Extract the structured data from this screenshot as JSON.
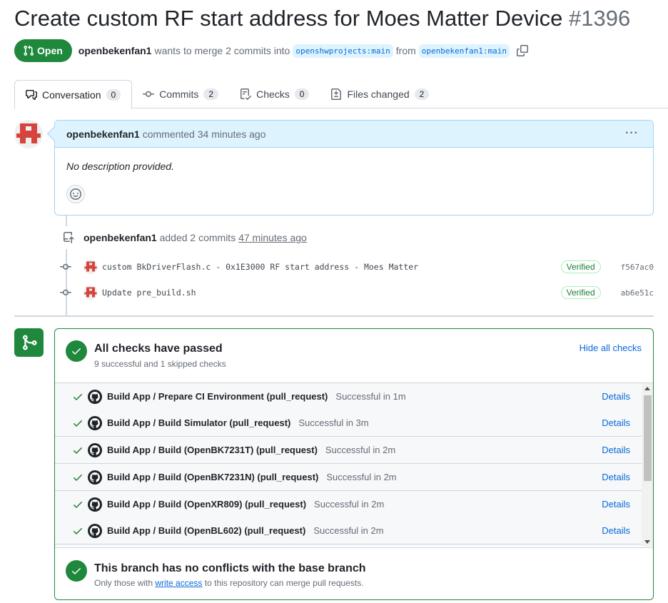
{
  "pr": {
    "title": "Create custom RF start address for Moes Matter Device",
    "number": "#1396",
    "state": "Open",
    "author": "openbekenfan1",
    "merge_text_1": "wants to merge 2 commits into",
    "base_branch": "openshwprojects:main",
    "merge_text_2": "from",
    "head_branch": "openbekenfan1:main"
  },
  "tabs": [
    {
      "label": "Conversation",
      "count": "0",
      "icon": "comment-discussion-icon"
    },
    {
      "label": "Commits",
      "count": "2",
      "icon": "git-commit-icon"
    },
    {
      "label": "Checks",
      "count": "0",
      "icon": "checklist-icon"
    },
    {
      "label": "Files changed",
      "count": "2",
      "icon": "file-diff-icon"
    }
  ],
  "comment": {
    "author": "openbekenfan1",
    "meta": "commented 34 minutes ago",
    "body": "No description provided.",
    "menu": "···"
  },
  "commits_event": {
    "author": "openbekenfan1",
    "text": "added 2 commits",
    "time": "47 minutes ago",
    "commits": [
      {
        "message": "custom BkDriverFlash.c - 0x1E3000 RF start address - Moes Matter",
        "verified": "Verified",
        "sha": "f567ac0"
      },
      {
        "message": "Update pre_build.sh",
        "verified": "Verified",
        "sha": "ab6e51c"
      }
    ]
  },
  "merge_box": {
    "checks_title": "All checks have passed",
    "checks_subtitle": "9 successful and 1 skipped checks",
    "hide_link": "Hide all checks",
    "checks": [
      {
        "name": "Build App / Prepare CI Environment (pull_request)",
        "status": "Successful in 1m",
        "details": "Details"
      },
      {
        "name": "Build App / Build Simulator (pull_request)",
        "status": "Successful in 3m",
        "details": "Details"
      },
      {
        "name": "Build App / Build (OpenBK7231T) (pull_request)",
        "status": "Successful in 2m",
        "details": "Details"
      },
      {
        "name": "Build App / Build (OpenBK7231N) (pull_request)",
        "status": "Successful in 2m",
        "details": "Details"
      },
      {
        "name": "Build App / Build (OpenXR809) (pull_request)",
        "status": "Successful in 2m",
        "details": "Details"
      },
      {
        "name": "Build App / Build (OpenBL602) (pull_request)",
        "status": "Successful in 2m",
        "details": "Details"
      }
    ],
    "conflict_title": "This branch has no conflicts with the base branch",
    "conflict_sub_1": "Only those with",
    "conflict_sub_link": "write access",
    "conflict_sub_2": "to this repository can merge pull requests."
  },
  "colors": {
    "open_green": "#1f883d",
    "link_blue": "#0969da",
    "comment_header_bg": "#ddf4ff",
    "avatar_red": "#d6453d"
  }
}
